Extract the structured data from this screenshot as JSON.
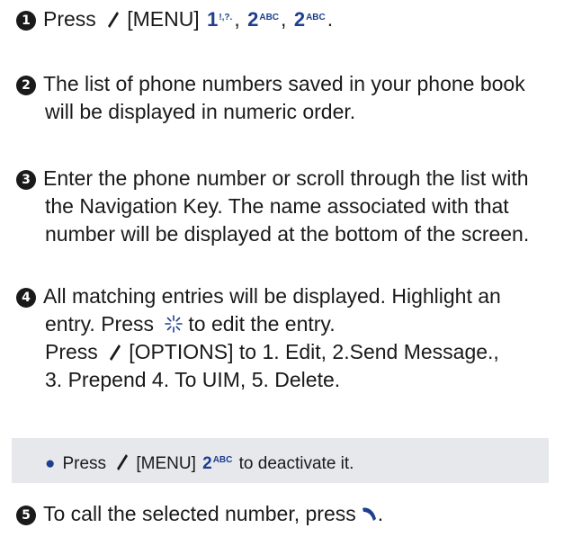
{
  "steps": [
    {
      "num": "1",
      "press": "Press",
      "menu": "[MENU]",
      "keys": [
        {
          "main": "1",
          "sub": "!,?.",
          "sep": ","
        },
        {
          "main": "2",
          "sub": "ABC",
          "sep": ","
        },
        {
          "main": "2",
          "sub": "ABC",
          "sep": "."
        }
      ]
    },
    {
      "num": "2",
      "lines": [
        "The list of phone numbers saved in your phone book",
        "will be displayed in numeric order."
      ]
    },
    {
      "num": "3",
      "lines": [
        "Enter the phone number or scroll through the list with",
        "the Navigation Key. The name associated with that",
        "number will be displayed at the bottom of the screen."
      ]
    },
    {
      "num": "4",
      "line1": "All matching entries will be displayed. Highlight an",
      "line2_a": "entry. Press",
      "line2_b": "to edit the entry.",
      "line3_a": "Press",
      "line3_b": "[OPTIONS] to 1. Edit, 2.Send Message.,",
      "line4": "3. Prepend 4. To UIM, 5. Delete."
    },
    {
      "num": "5",
      "text": "To call the selected number, press",
      "end": "."
    }
  ],
  "note": {
    "press": "Press",
    "menu": "[MENU]",
    "key_main": "2",
    "key_sub": "ABC",
    "after": "to deactivate it."
  },
  "colors": {
    "accent": "#1d3f8f",
    "note_bg": "#e6e8ec"
  }
}
